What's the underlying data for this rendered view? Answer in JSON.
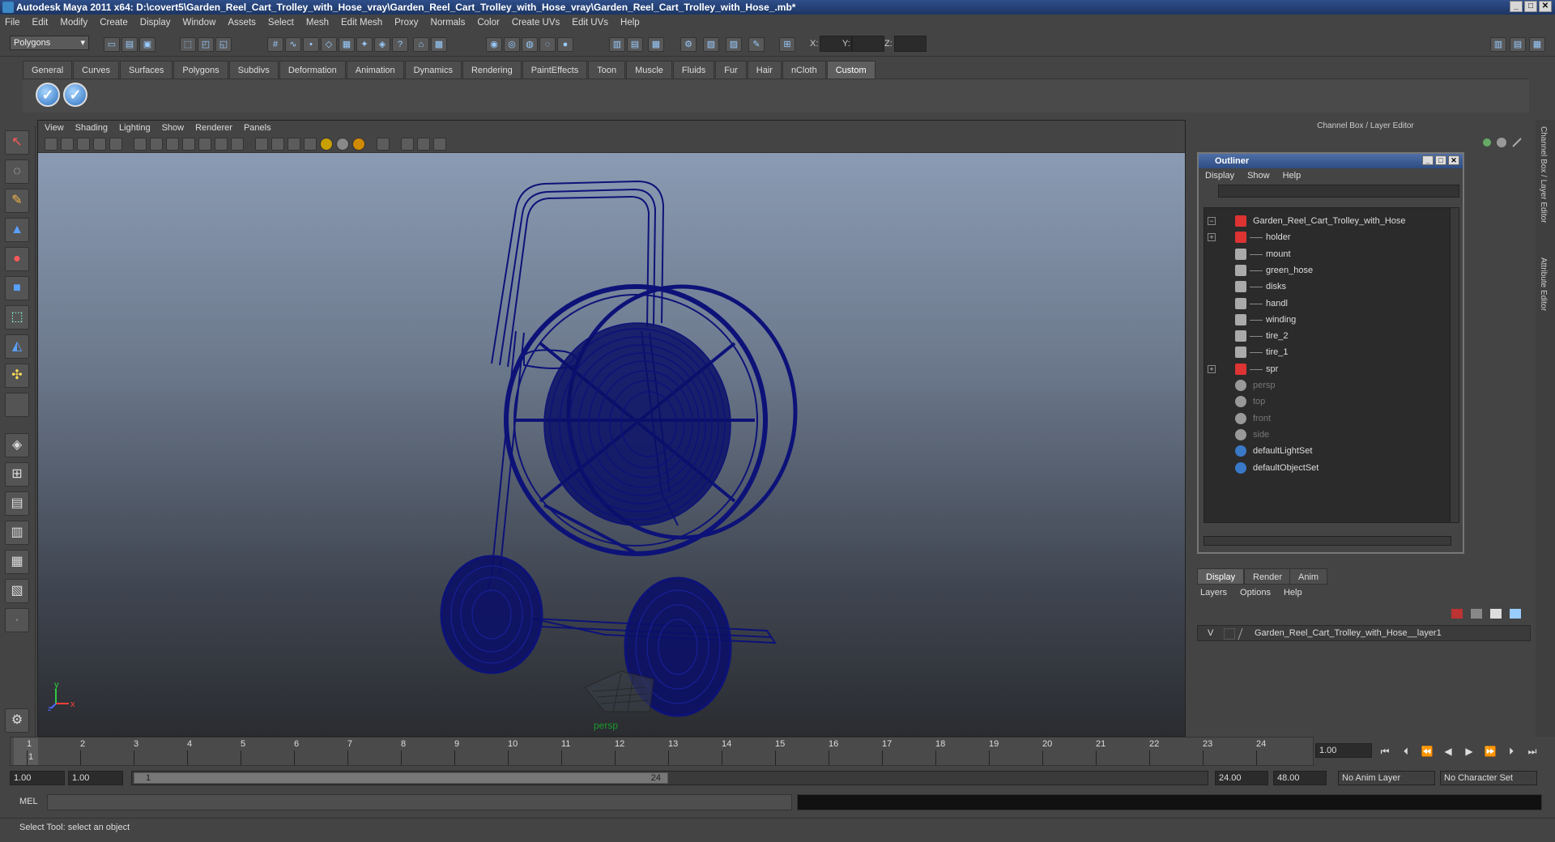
{
  "window": {
    "title": "Autodesk Maya 2011 x64: D:\\covert5\\Garden_Reel_Cart_Trolley_with_Hose_vray\\Garden_Reel_Cart_Trolley_with_Hose_vray\\Garden_Reel_Cart_Trolley_with_Hose_.mb*",
    "min_label": "_",
    "max_label": "□",
    "close_label": "✕"
  },
  "menubar": [
    "File",
    "Edit",
    "Modify",
    "Create",
    "Display",
    "Window",
    "Assets",
    "Select",
    "Mesh",
    "Edit Mesh",
    "Proxy",
    "Normals",
    "Color",
    "Create UVs",
    "Edit UVs",
    "Help"
  ],
  "statusline": {
    "mode": "Polygons",
    "x_label": "X:",
    "y_label": "Y:",
    "z_label": "Z:"
  },
  "shelf": {
    "tabs": [
      "General",
      "Curves",
      "Surfaces",
      "Polygons",
      "Subdivs",
      "Deformation",
      "Animation",
      "Dynamics",
      "Rendering",
      "PaintEffects",
      "Toon",
      "Muscle",
      "Fluids",
      "Fur",
      "Hair",
      "nCloth",
      "Custom"
    ],
    "active_tab": "Custom"
  },
  "viewport": {
    "menu": [
      "View",
      "Shading",
      "Lighting",
      "Show",
      "Renderer",
      "Panels"
    ],
    "camera": "persp",
    "axis_x": "x",
    "axis_y": "y",
    "axis_z": "z",
    "wire_color": "#0d1278"
  },
  "right_panel": {
    "header": "Channel Box / Layer Editor"
  },
  "side_tabs": [
    "Channel Box / Layer Editor",
    "Attribute Editor"
  ],
  "outliner": {
    "title": "Outliner",
    "menu": [
      "Display",
      "Show",
      "Help"
    ],
    "items": [
      {
        "label": "Garden_Reel_Cart_Trolley_with_Hose",
        "level": 0,
        "kind": "group",
        "expand": "⊟",
        "dim": false
      },
      {
        "label": "holder",
        "level": 1,
        "kind": "group",
        "expand": "⊞",
        "dim": false
      },
      {
        "label": "mount",
        "level": 1,
        "kind": "mesh",
        "expand": "",
        "dim": false
      },
      {
        "label": "green_hose",
        "level": 1,
        "kind": "mesh",
        "expand": "",
        "dim": false
      },
      {
        "label": "disks",
        "level": 1,
        "kind": "mesh",
        "expand": "",
        "dim": false
      },
      {
        "label": "handl",
        "level": 1,
        "kind": "mesh",
        "expand": "",
        "dim": false
      },
      {
        "label": "winding",
        "level": 1,
        "kind": "mesh",
        "expand": "",
        "dim": false
      },
      {
        "label": "tire_2",
        "level": 1,
        "kind": "mesh",
        "expand": "",
        "dim": false
      },
      {
        "label": "tire_1",
        "level": 1,
        "kind": "mesh",
        "expand": "",
        "dim": false
      },
      {
        "label": "spr",
        "level": 1,
        "kind": "group",
        "expand": "⊞",
        "dim": false
      },
      {
        "label": "persp",
        "level": 0,
        "kind": "camera",
        "expand": "",
        "dim": true
      },
      {
        "label": "top",
        "level": 0,
        "kind": "camera",
        "expand": "",
        "dim": true
      },
      {
        "label": "front",
        "level": 0,
        "kind": "camera",
        "expand": "",
        "dim": true
      },
      {
        "label": "side",
        "level": 0,
        "kind": "camera",
        "expand": "",
        "dim": true
      },
      {
        "label": "defaultLightSet",
        "level": 0,
        "kind": "set",
        "expand": "",
        "dim": false
      },
      {
        "label": "defaultObjectSet",
        "level": 0,
        "kind": "set",
        "expand": "",
        "dim": false
      }
    ]
  },
  "layer_editor": {
    "tabs": [
      "Display",
      "Render",
      "Anim"
    ],
    "active_tab": "Display",
    "menu": [
      "Layers",
      "Options",
      "Help"
    ],
    "layer": {
      "visible": "V",
      "name": "Garden_Reel_Cart_Trolley_with_Hose__layer1"
    }
  },
  "timeline": {
    "ticks": [
      "1",
      "2",
      "3",
      "4",
      "5",
      "6",
      "7",
      "8",
      "9",
      "10",
      "11",
      "12",
      "13",
      "14",
      "15",
      "16",
      "17",
      "18",
      "19",
      "20",
      "21",
      "22",
      "23",
      "24"
    ],
    "current_frame": "1",
    "current_time_field": "1.00"
  },
  "range": {
    "start": "1.00",
    "playback_start": "1.00",
    "slider_start": "1",
    "slider_end": "24",
    "playback_end": "24.00",
    "end": "48.00",
    "anim_layer": "No Anim Layer",
    "character_set": "No Character Set"
  },
  "cmdline": {
    "label": "MEL"
  },
  "status": {
    "help_text": "Select Tool: select an object"
  }
}
